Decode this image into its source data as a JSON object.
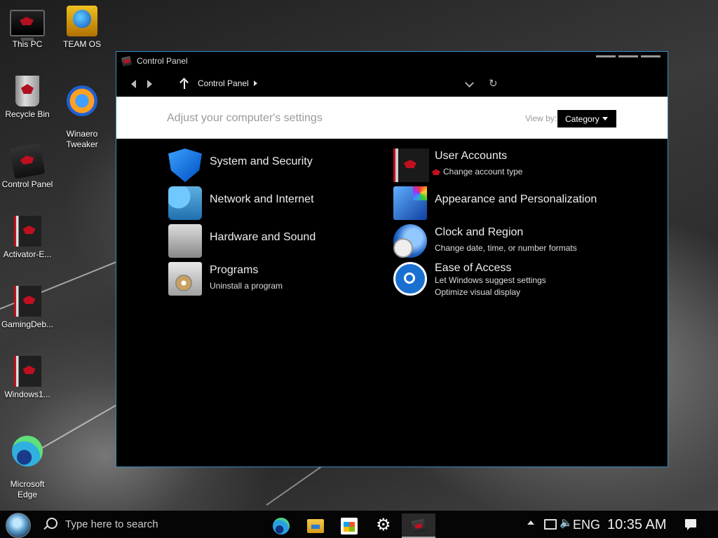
{
  "desktop": {
    "icons": [
      {
        "label": "This PC"
      },
      {
        "label": "TEAM OS"
      },
      {
        "label": "Recycle Bin"
      },
      {
        "label": "Winaero\nTweaker"
      },
      {
        "label": "Control Panel"
      },
      {
        "label": "Activator-E..."
      },
      {
        "label": "GamingDeb..."
      },
      {
        "label": "Windows1..."
      },
      {
        "label": "Microsoft\nEdge"
      }
    ]
  },
  "window": {
    "title": "Control Panel",
    "breadcrumb": "Control Panel",
    "header": "Adjust your computer's settings",
    "view_by_label": "View by:",
    "view_by_value": "Category",
    "categories": [
      {
        "name": "System and Security",
        "icon": "shield-icon"
      },
      {
        "name": "Network and Internet",
        "icon": "network-icon"
      },
      {
        "name": "Hardware and Sound",
        "icon": "printer-icon"
      },
      {
        "name": "Programs",
        "icon": "programs-icon",
        "links": [
          "Uninstall a program"
        ]
      },
      {
        "name": "User Accounts",
        "icon": "user-accounts-icon",
        "links": [
          "Change account type"
        ]
      },
      {
        "name": "Appearance and Personalization",
        "icon": "appearance-icon"
      },
      {
        "name": "Clock and Region",
        "icon": "clock-icon",
        "links": [
          "Change date, time, or number formats"
        ]
      },
      {
        "name": "Ease of Access",
        "icon": "ease-of-access-icon",
        "links": [
          "Let Windows suggest settings",
          "Optimize visual display"
        ]
      }
    ]
  },
  "taskbar": {
    "search_placeholder": "Type here to search",
    "language": "ENG",
    "time": "10:35 AM",
    "pinned": [
      "edge-icon",
      "file-explorer-icon",
      "store-icon",
      "settings-icon",
      "control-panel-icon"
    ]
  }
}
